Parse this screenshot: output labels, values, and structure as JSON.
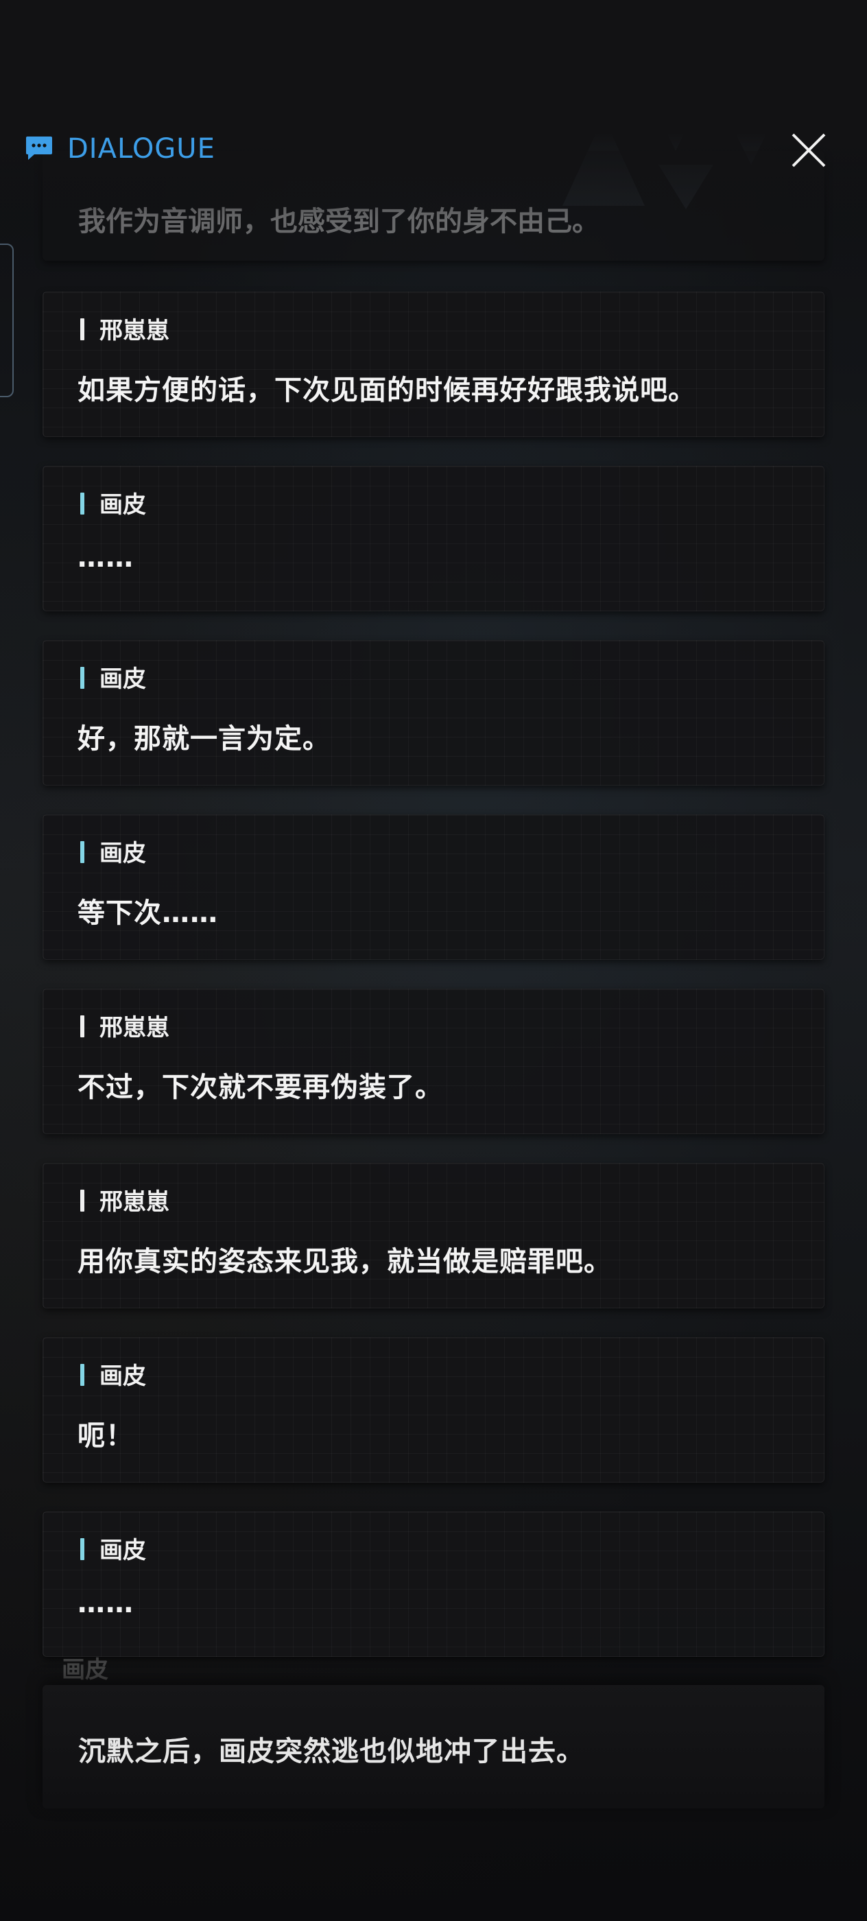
{
  "header": {
    "title": "DIALOGUE",
    "icon": "chat-bubble-icon",
    "close_icon": "close-icon",
    "accent_color": "#3d9ee8"
  },
  "partial_top_line": "我作为音调师，也感受到了你的身不由己。",
  "dialogue": [
    {
      "speaker": "邢崽崽",
      "text": "如果方便的话，下次见面的时候再好好跟我说吧。",
      "bar": "white"
    },
    {
      "speaker": "画皮",
      "text": "……",
      "bar": "cyan"
    },
    {
      "speaker": "画皮",
      "text": "好，那就一言为定。",
      "bar": "cyan"
    },
    {
      "speaker": "画皮",
      "text": "等下次……",
      "bar": "cyan"
    },
    {
      "speaker": "邢崽崽",
      "text": "不过，下次就不要再伪装了。",
      "bar": "white"
    },
    {
      "speaker": "邢崽崽",
      "text": "用你真实的姿态来见我，就当做是赔罪吧。",
      "bar": "white"
    },
    {
      "speaker": "画皮",
      "text": "呃！",
      "bar": "cyan"
    },
    {
      "speaker": "画皮",
      "text": "……",
      "bar": "cyan"
    }
  ],
  "ghost_speaker": "画皮",
  "narration": "沉默之后，画皮突然逃也似地冲了出去。"
}
